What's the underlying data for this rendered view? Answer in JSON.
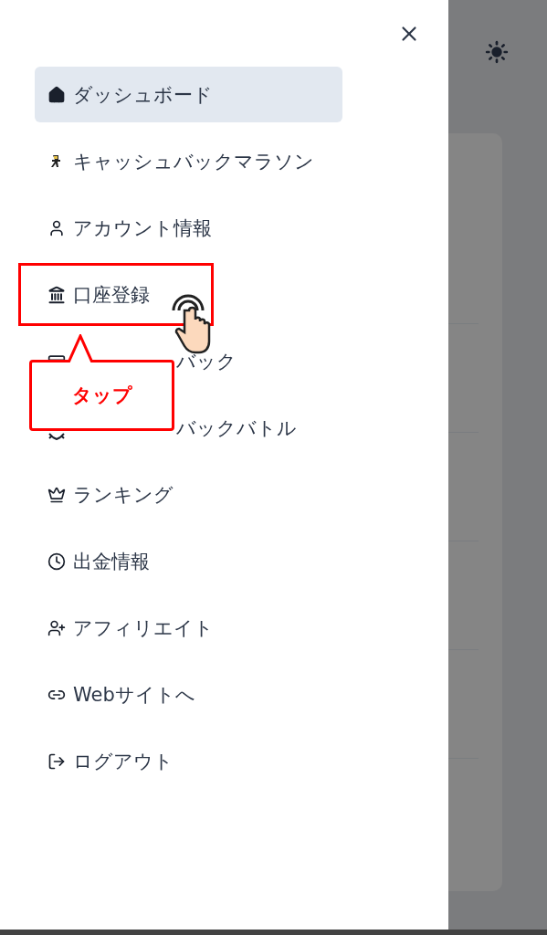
{
  "drawer": {
    "items": [
      {
        "kind": "home",
        "label": "ダッシュボード",
        "selected": true
      },
      {
        "kind": "runner",
        "label": "キャッシュバックマラソン",
        "selected": false
      },
      {
        "kind": "user",
        "label": "アカウント情報",
        "selected": false
      },
      {
        "kind": "bank",
        "label": "口座登録",
        "selected": false
      },
      {
        "kind": "card",
        "label": "バック",
        "selected": false,
        "partially_hidden": true
      },
      {
        "kind": "battle",
        "label": "バックバトル",
        "selected": false,
        "partially_hidden": true
      },
      {
        "kind": "crown",
        "label": "ランキング",
        "selected": false
      },
      {
        "kind": "clock",
        "label": "出金情報",
        "selected": false
      },
      {
        "kind": "affiliate",
        "label": "アフィリエイト",
        "selected": false
      },
      {
        "kind": "link",
        "label": "Webサイトへ",
        "selected": false
      },
      {
        "kind": "logout",
        "label": "ログアウト",
        "selected": false
      }
    ]
  },
  "callout": {
    "text": "タップ"
  }
}
